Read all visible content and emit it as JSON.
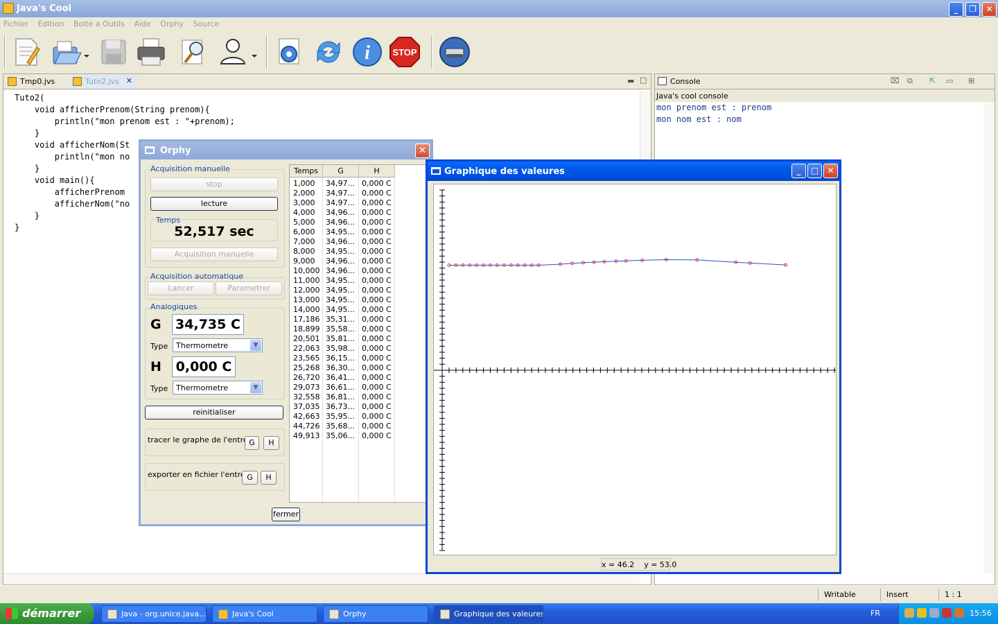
{
  "app": {
    "title": "Java's Cool",
    "menu": [
      "Fichier",
      "Edition",
      "Boite a Outils",
      "Aide",
      "Orphy",
      "Source"
    ],
    "toolbar_icons": [
      "new-file-icon",
      "open-file-icon",
      "save-icon",
      "print-icon",
      "search-icon",
      "user-icon",
      "settings-icon",
      "refresh-icon",
      "info-icon",
      "stop-icon",
      "device-icon"
    ],
    "stop_label": "STOP"
  },
  "editor": {
    "tabs": [
      {
        "label": "Tmp0.jvs"
      },
      {
        "label": "Tuto2.jvs"
      }
    ],
    "code_lines": [
      "Tuto2(",
      "",
      "    void afficherPrenom(String prenom){",
      "        println(\"mon prenom est : \"+prenom);",
      "    }",
      "",
      "    void afficherNom(St",
      "        println(\"mon no",
      "    }",
      "    void main(){",
      "",
      "        afficherPrenom",
      "",
      "        afficherNom(\"no",
      "    }",
      "}"
    ]
  },
  "console": {
    "tab_label": "Console",
    "subtitle": "Java's cool console",
    "lines": [
      "mon prenom est : prenom",
      "mon nom est : nom"
    ]
  },
  "statusbar": {
    "mode": "Writable",
    "insert": "Insert",
    "position": "1 : 1"
  },
  "orphy": {
    "title": "Orphy",
    "manual": {
      "group_label": "Acquisition manuelle",
      "stop_label": "stop",
      "read_label": "lecture",
      "time_label": "Temps",
      "time_value": "52,517 sec",
      "acq_label": "Acquisition manuelle"
    },
    "auto": {
      "group_label": "Acquisition automatique",
      "launch_label": "Lancer",
      "params_label": "Parametrer"
    },
    "analog": {
      "group_label": "Analogiques",
      "g_label": "G",
      "g_value": "34,735 C",
      "h_label": "H",
      "h_value": "0,000 C",
      "type_label": "Type",
      "type_value": "Thermometre"
    },
    "reset_label": "reinitialiser",
    "trace_label": "tracer le graphe de l'entree",
    "export_label": "exporter en fichier l'entree",
    "g_btn": "G",
    "h_btn": "H",
    "close_label": "fermer",
    "table": {
      "headers": [
        "Temps",
        "G",
        "H"
      ],
      "rows": [
        [
          "1,000",
          "34,97...",
          "0,000 C"
        ],
        [
          "2,000",
          "34,97...",
          "0,000 C"
        ],
        [
          "3,000",
          "34,97...",
          "0,000 C"
        ],
        [
          "4,000",
          "34,96...",
          "0,000 C"
        ],
        [
          "5,000",
          "34,96...",
          "0,000 C"
        ],
        [
          "6,000",
          "34,95...",
          "0,000 C"
        ],
        [
          "7,000",
          "34,96...",
          "0,000 C"
        ],
        [
          "8,000",
          "34,95...",
          "0,000 C"
        ],
        [
          "9,000",
          "34,96...",
          "0,000 C"
        ],
        [
          "10,000",
          "34,96...",
          "0,000 C"
        ],
        [
          "11,000",
          "34,95...",
          "0,000 C"
        ],
        [
          "12,000",
          "34,95...",
          "0,000 C"
        ],
        [
          "13,000",
          "34,95...",
          "0,000 C"
        ],
        [
          "14,000",
          "34,95...",
          "0,000 C"
        ],
        [
          "17,186",
          "35,31...",
          "0,000 C"
        ],
        [
          "18,899",
          "35,58...",
          "0,000 C"
        ],
        [
          "20,501",
          "35,81...",
          "0,000 C"
        ],
        [
          "22,063",
          "35,98...",
          "0,000 C"
        ],
        [
          "23,565",
          "36,15...",
          "0,000 C"
        ],
        [
          "25,268",
          "36,30...",
          "0,000 C"
        ],
        [
          "26,720",
          "36,41...",
          "0,000 C"
        ],
        [
          "29,073",
          "36,61...",
          "0,000 C"
        ],
        [
          "32,558",
          "36,81...",
          "0,000 C"
        ],
        [
          "37,035",
          "36,73...",
          "0,000 C"
        ],
        [
          "42,663",
          "35,95...",
          "0,000 C"
        ],
        [
          "44,726",
          "35,68...",
          "0,000 C"
        ],
        [
          "49,913",
          "35,06...",
          "0,000 C"
        ]
      ]
    }
  },
  "graph": {
    "title": "Graphique des valeures",
    "coord_readout": "x = 46.2    y = 53.0",
    "curve_color": "#2a4fd0",
    "marker_color": "#d04040"
  },
  "chart_data": {
    "type": "line",
    "x": [
      1.0,
      2.0,
      3.0,
      4.0,
      5.0,
      6.0,
      7.0,
      8.0,
      9.0,
      10.0,
      11.0,
      12.0,
      13.0,
      14.0,
      17.186,
      18.899,
      20.501,
      22.063,
      23.565,
      25.268,
      26.72,
      29.073,
      32.558,
      37.035,
      42.663,
      44.726,
      49.913
    ],
    "y": [
      34.97,
      34.97,
      34.97,
      34.96,
      34.96,
      34.95,
      34.96,
      34.95,
      34.96,
      34.96,
      34.95,
      34.95,
      34.95,
      34.95,
      35.31,
      35.58,
      35.81,
      35.98,
      36.15,
      36.3,
      36.41,
      36.61,
      36.81,
      36.73,
      35.95,
      35.68,
      35.06
    ],
    "xlim": [
      0,
      57
    ],
    "ylim": [
      -60,
      60
    ],
    "grid": false
  },
  "taskbar": {
    "start_label": "démarrer",
    "tasks": [
      {
        "label": "Java - org.unice.java..."
      },
      {
        "label": "Java's Cool"
      },
      {
        "label": "Orphy"
      },
      {
        "label": "Graphique des valeures"
      }
    ],
    "lang": "FR",
    "clock": "15:56"
  }
}
